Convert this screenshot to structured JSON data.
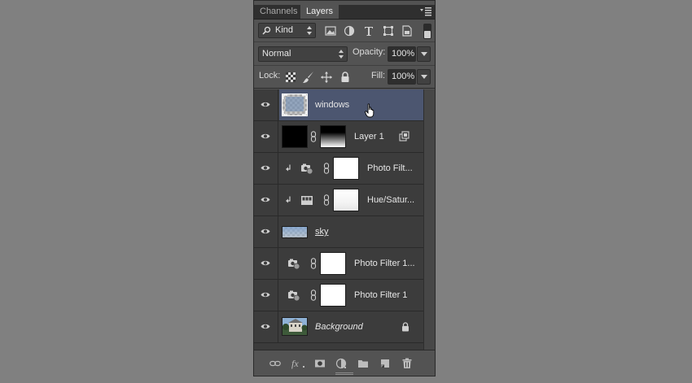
{
  "tabs": [
    {
      "label": "Channels",
      "active": false
    },
    {
      "label": "Layers",
      "active": true
    }
  ],
  "filter": {
    "kind_label": "Kind",
    "icons": [
      "pixel-filter-icon",
      "adjustment-filter-icon",
      "type-filter-icon",
      "shape-filter-icon",
      "smart-object-filter-icon"
    ]
  },
  "blend": {
    "mode": "Normal",
    "opacity_label": "Opacity:",
    "opacity_value": "100%"
  },
  "lock": {
    "label": "Lock:",
    "icons": [
      "lock-transparent-pixels-icon",
      "lock-image-pixels-icon",
      "lock-position-icon",
      "lock-all-icon"
    ],
    "fill_label": "Fill:",
    "fill_value": "100%"
  },
  "layers": [
    {
      "name": "windows",
      "selected": true,
      "style": "normal"
    },
    {
      "name": "Layer 1",
      "selected": false,
      "style": "normal"
    },
    {
      "name": "Photo Filt...",
      "selected": false,
      "style": "normal"
    },
    {
      "name": "Hue/Satur...",
      "selected": false,
      "style": "normal"
    },
    {
      "name": "sky",
      "selected": false,
      "style": "underline"
    },
    {
      "name": "Photo Filter 1...",
      "selected": false,
      "style": "normal"
    },
    {
      "name": "Photo Filter 1",
      "selected": false,
      "style": "normal"
    },
    {
      "name": "Background",
      "selected": false,
      "style": "italic"
    }
  ],
  "bottom_icons": [
    "link-layers-icon",
    "fx-icon",
    "layer-mask-icon",
    "adjustment-layer-icon",
    "group-folder-icon",
    "new-layer-icon",
    "trash-icon"
  ],
  "colors": {
    "canvas_bg": "#808080",
    "panel_bg": "#535353",
    "selected_row": "#4c5670"
  }
}
